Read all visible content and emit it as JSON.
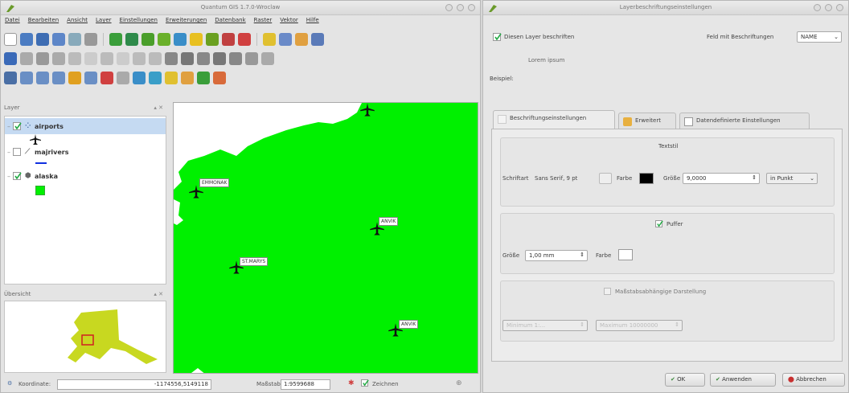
{
  "qgis": {
    "title": "Quantum GIS 1.7.0-Wroclaw",
    "menu": [
      "Datei",
      "Bearbeiten",
      "Ansicht",
      "Layer",
      "Einstellungen",
      "Erweiterungen",
      "Datenbank",
      "Raster",
      "Vektor",
      "Hilfe"
    ],
    "layer_panel_title": "Layer",
    "overview_panel_title": "Übersicht",
    "layers": [
      {
        "name": "airports",
        "checked": true
      },
      {
        "name": "majrivers",
        "checked": false
      },
      {
        "name": "alaska",
        "checked": true
      }
    ],
    "map_labels": [
      "EMMONAK",
      "ANVIK",
      "ST.MARYS",
      "ANVIK"
    ],
    "status": {
      "coord_label": "Koordinate:",
      "coord_value": "-1174556,5149118",
      "scale_label": "Maßstab",
      "scale_value": "1:9599688",
      "render_label": "Zeichnen"
    },
    "colors": {
      "land": "#00f000",
      "sea": "#ffffff",
      "accent": "#4a6fa5"
    }
  },
  "dialog": {
    "title": "Layerbeschriftungseinstellungen",
    "label_layer": "Diesen Layer beschriften",
    "field_label": "Feld mit Beschriftungen",
    "field_value": "NAME",
    "preview_text": "Lorem ipsum",
    "example_label": "Beispiel:",
    "tabs": [
      "Beschriftungseinstellungen",
      "Erweitert",
      "Datendefinierte Einstellungen"
    ],
    "textstil": {
      "title": "Textstil",
      "font_label": "Schriftart",
      "font_value": "Sans Serif, 9 pt",
      "color_label": "Farbe",
      "size_label": "Größe",
      "size_value": "9,0000",
      "unit_value": "in Punkt"
    },
    "puffer": {
      "title": "Puffer",
      "size_label": "Größe",
      "size_value": "1,00 mm",
      "color_label": "Farbe"
    },
    "scale_dep": {
      "title": "Maßstabsabhängige Darstellung",
      "min_value": "Minimum 1:...",
      "max_value": "Maximum 10000000"
    },
    "buttons": {
      "ok": "OK",
      "apply": "Anwenden",
      "cancel": "Abbrechen"
    }
  }
}
